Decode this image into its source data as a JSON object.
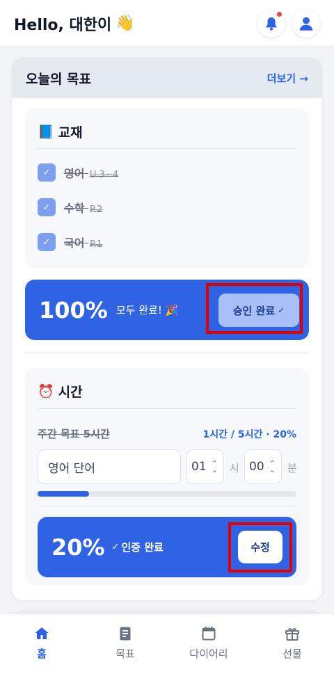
{
  "header": {
    "greeting": "Hello, 대한이",
    "wave": "👋",
    "notification_dot_color": "#ef4444"
  },
  "goals": {
    "title": "오늘의 목표",
    "more_label": "더보기 →",
    "textbook": {
      "icon": "📘",
      "title": "교재",
      "items": [
        {
          "subject": "영어",
          "range": "U.3~4",
          "checked": true
        },
        {
          "subject": "수학",
          "range": "P.2",
          "checked": true
        },
        {
          "subject": "국어",
          "range": "P.1",
          "checked": true
        }
      ],
      "progress_percent": "100%",
      "progress_message": "모두 완료! 🎉",
      "approve_label": "승인 완료",
      "approve_tick": "✓"
    },
    "time": {
      "icon": "⏰",
      "title": "시간",
      "weekly_goal_label": "주간 목표 5시간",
      "weekly_stat": "1시간 / 5시간 · 20%",
      "activity_value": "영어 단어",
      "hours_value": "01",
      "hours_unit": "시",
      "minutes_value": "00",
      "minutes_unit": "분",
      "progress_fraction": 0.2,
      "progress_percent": "20%",
      "verified_tick": "✓",
      "verified_label": "인증 완료",
      "edit_label": "수정"
    }
  },
  "nav": {
    "items": [
      {
        "label": "홈",
        "icon": "home-icon",
        "active": true
      },
      {
        "label": "목표",
        "icon": "document-icon",
        "active": false
      },
      {
        "label": "다이어리",
        "icon": "calendar-icon",
        "active": false
      },
      {
        "label": "선물",
        "icon": "gift-icon",
        "active": false
      }
    ]
  },
  "colors": {
    "accent": "#2f63e4",
    "highlight": "#e00000"
  }
}
